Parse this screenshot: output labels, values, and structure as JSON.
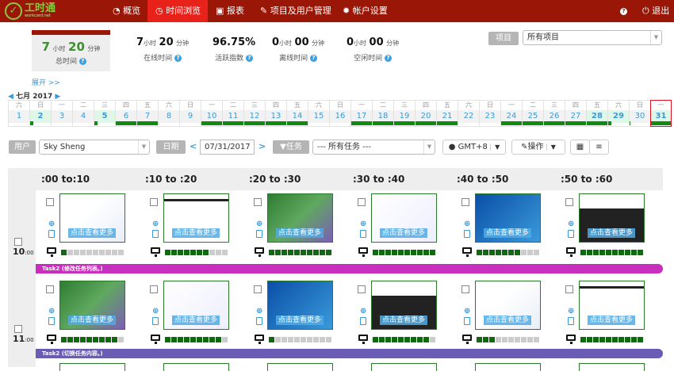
{
  "nav": {
    "logo_text": "工时通",
    "logo_sub": "workcard.net",
    "items": [
      {
        "label": "概览",
        "icon": "dashboard-icon"
      },
      {
        "label": "时间浏览",
        "icon": "clock-icon",
        "active": true
      },
      {
        "label": "报表",
        "icon": "report-icon"
      },
      {
        "label": "项目及用户管理",
        "icon": "wrench-icon"
      },
      {
        "label": "帐户设置",
        "icon": "gear-icon"
      }
    ],
    "help_icon": "?",
    "logout": "退出"
  },
  "summary": {
    "total": {
      "hours": "7",
      "h_unit": "小时",
      "minutes": "20",
      "m_unit": "分钟",
      "label": "总时间"
    },
    "stats": [
      {
        "hours": "7",
        "minutes": "20",
        "label": "在线时间"
      },
      {
        "value": "96.75%",
        "label": "活跃指数"
      },
      {
        "hours": "0",
        "minutes": "00",
        "label": "离线时间"
      },
      {
        "hours": "0",
        "minutes": "00",
        "label": "空闲时间"
      }
    ],
    "expand": "展开 >>"
  },
  "project": {
    "label": "项目",
    "value": "所有项目"
  },
  "calendar": {
    "month": "七月 2017",
    "days": [
      {
        "d": "1",
        "w": "六",
        "bar": 0
      },
      {
        "d": "2",
        "w": "日",
        "bar": 0.15,
        "hl": true
      },
      {
        "d": "3",
        "w": "一",
        "bar": 0
      },
      {
        "d": "4",
        "w": "二",
        "bar": 0
      },
      {
        "d": "5",
        "w": "三",
        "bar": 0.15,
        "hl": true
      },
      {
        "d": "6",
        "w": "四",
        "bar": 1
      },
      {
        "d": "7",
        "w": "五",
        "bar": 1
      },
      {
        "d": "8",
        "w": "六",
        "bar": 0
      },
      {
        "d": "9",
        "w": "日",
        "bar": 0
      },
      {
        "d": "10",
        "w": "一",
        "bar": 1
      },
      {
        "d": "11",
        "w": "二",
        "bar": 1
      },
      {
        "d": "12",
        "w": "三",
        "bar": 1
      },
      {
        "d": "13",
        "w": "四",
        "bar": 1
      },
      {
        "d": "14",
        "w": "五",
        "bar": 1
      },
      {
        "d": "15",
        "w": "六",
        "bar": 0
      },
      {
        "d": "16",
        "w": "日",
        "bar": 0
      },
      {
        "d": "17",
        "w": "一",
        "bar": 1
      },
      {
        "d": "18",
        "w": "二",
        "bar": 1
      },
      {
        "d": "19",
        "w": "三",
        "bar": 1
      },
      {
        "d": "20",
        "w": "四",
        "bar": 1
      },
      {
        "d": "21",
        "w": "五",
        "bar": 1
      },
      {
        "d": "22",
        "w": "六",
        "bar": 0
      },
      {
        "d": "23",
        "w": "日",
        "bar": 0
      },
      {
        "d": "24",
        "w": "一",
        "bar": 1
      },
      {
        "d": "25",
        "w": "二",
        "bar": 1
      },
      {
        "d": "26",
        "w": "三",
        "bar": 1
      },
      {
        "d": "27",
        "w": "四",
        "bar": 1
      },
      {
        "d": "28",
        "w": "五",
        "bar": 1,
        "hl": true
      },
      {
        "d": "29",
        "w": "六",
        "bar": 0.15,
        "hl": true
      },
      {
        "d": "30",
        "w": "日",
        "bar": 0.05
      },
      {
        "d": "31",
        "w": "一",
        "bar": 1,
        "hl": true,
        "selected": true
      }
    ]
  },
  "toolbar": {
    "user_label": "用户",
    "user_value": "Sky Sheng",
    "date_label": "日期",
    "date_value": "07/31/2017",
    "task_label": "任务",
    "task_value": "--- 所有任务 ---",
    "timezone": "GMT+8",
    "ops": "操作"
  },
  "grid": {
    "columns": [
      ":00 to:10",
      ":10 to :20",
      ":20 to :30",
      ":30 to :40",
      ":40 to :50",
      ":50 to :60"
    ],
    "caption": "点击查看更多",
    "rows": [
      {
        "hour": "10",
        "min": ":00",
        "activity": [
          1,
          7,
          10,
          10,
          7,
          10
        ],
        "task": "Task2 (修改任务列表。)",
        "task_color": "#c92fbd"
      },
      {
        "hour": "11",
        "min": ":00",
        "activity": [
          9,
          9,
          1,
          9,
          3,
          10
        ],
        "task": "Task2 (切换任务内容。)",
        "task_color": "#6a5bb5"
      }
    ]
  }
}
